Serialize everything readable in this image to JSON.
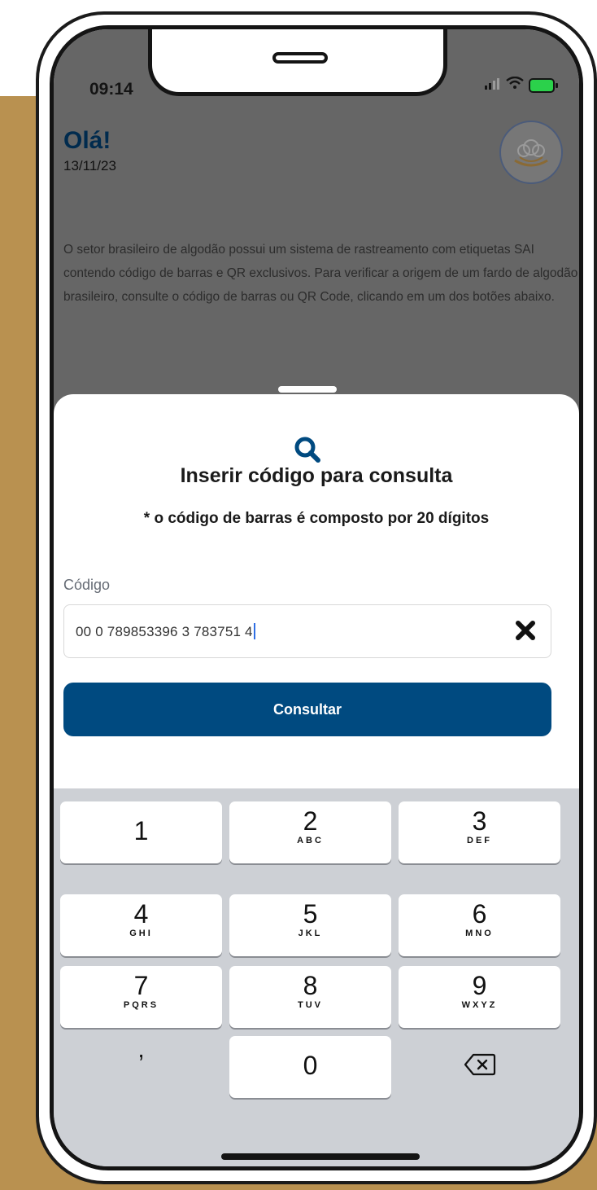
{
  "status_bar": {
    "time": "09:14",
    "signal_icon": "signal-bars-icon",
    "wifi_icon": "wifi-icon",
    "battery_icon": "battery-charging-icon"
  },
  "header": {
    "greeting": "Olá!",
    "date": "13/11/23",
    "avatar_icon": "cotton-logo-icon"
  },
  "intro_text": "O setor brasileiro de algodão possui um sistema de rastreamento com etiquetas SAI contendo código de barras e QR exclusivos. Para verificar a origem de um fardo de algodão brasileiro, consulte o código de barras ou QR Code, clicando em um dos botões abaixo.",
  "sheet": {
    "icon": "search-icon",
    "title": "Inserir código para consulta",
    "note": "* o código de barras é composto por 20 dígitos",
    "field_label": "Código",
    "field_value": "00 0 789853396 3 783751 4",
    "clear_icon": "close-icon",
    "button_label": "Consultar"
  },
  "keyboard": {
    "keys": [
      {
        "digit": "1",
        "letters": ""
      },
      {
        "digit": "2",
        "letters": "ABC"
      },
      {
        "digit": "3",
        "letters": "DEF"
      },
      {
        "digit": "4",
        "letters": "GHI"
      },
      {
        "digit": "5",
        "letters": "JKL"
      },
      {
        "digit": "6",
        "letters": "MNO"
      },
      {
        "digit": "7",
        "letters": "PQRS"
      },
      {
        "digit": "8",
        "letters": "TUV"
      },
      {
        "digit": "9",
        "letters": "WXYZ"
      },
      {
        "digit": "0",
        "letters": ""
      }
    ],
    "comma": ",",
    "backspace_icon": "backspace-icon"
  },
  "colors": {
    "brand_navy": "#004a80",
    "background_gold": "#b99150",
    "heading_navy": "#002b4e"
  }
}
